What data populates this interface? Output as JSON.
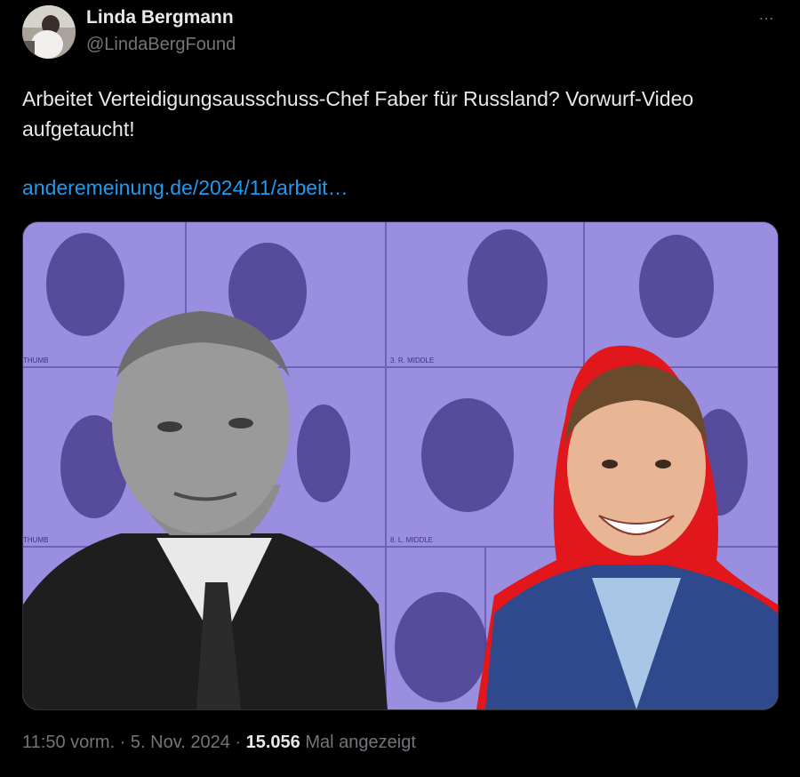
{
  "author": {
    "name": "Linda Bergmann",
    "handle": "@LindaBergFound",
    "avatar_icon": "profile-photo"
  },
  "more_icon": "…",
  "tweet": {
    "text": "Arbeitet Verteidigungsausschuss-Chef Faber für Russland? Vorwurf-Video aufgetaucht!",
    "link": "anderemeinung.de/2024/11/arbeit…"
  },
  "media": {
    "labels": {
      "thumb_top": "THUMB",
      "r_middle": "3. R. MIDDLE",
      "thumb_bottom": "THUMB",
      "l_middle": "8. L. MIDDLE"
    },
    "colors": {
      "background": "#9a8ee0",
      "fingerprint": "#4b3f8f",
      "outline": "#e2171b"
    }
  },
  "footer": {
    "time": "11:50 vorm.",
    "sep1": " · ",
    "date": "5. Nov. 2024",
    "sep2": " · ",
    "views": "15.056",
    "views_label": " Mal angezeigt"
  }
}
